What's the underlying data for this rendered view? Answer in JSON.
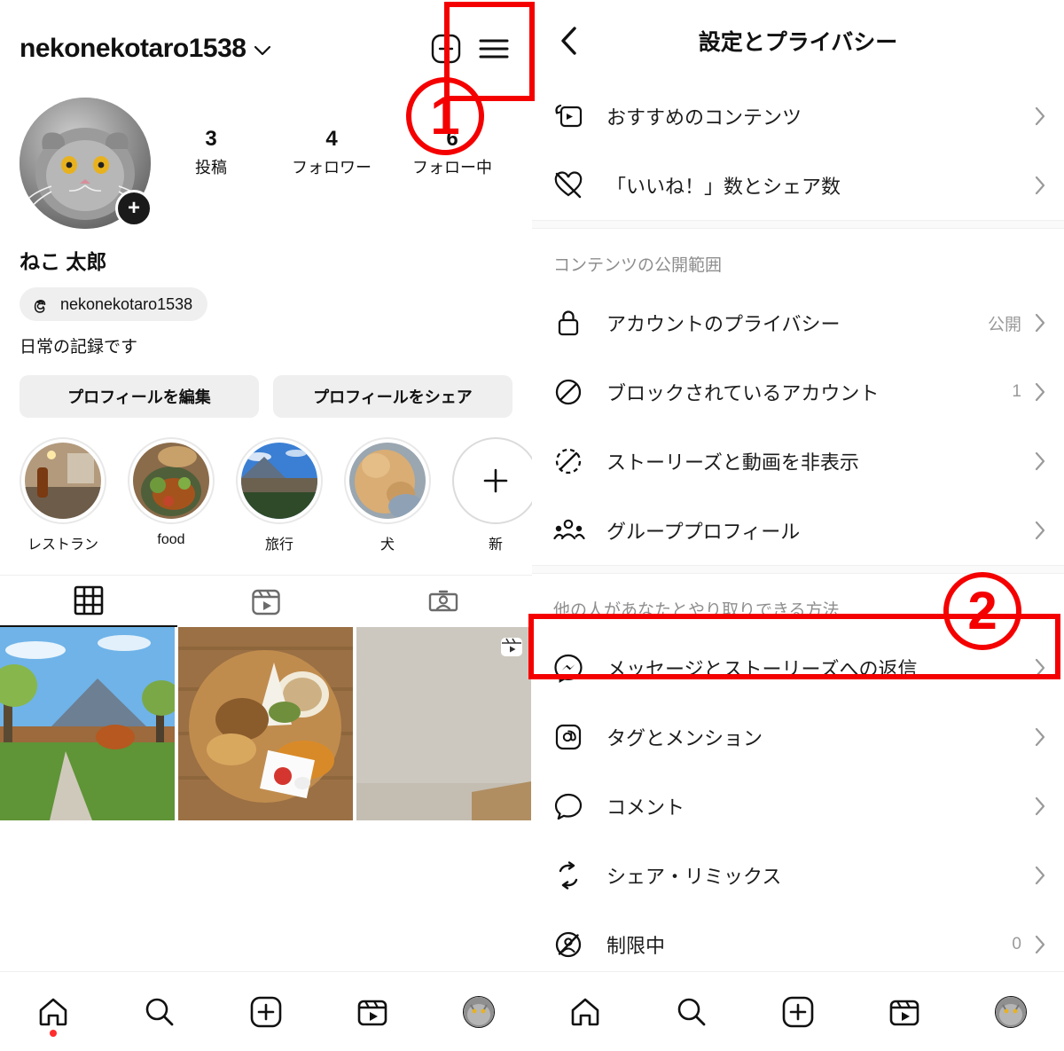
{
  "profile": {
    "username": "nekonekotaro1538",
    "display_name": "ねこ 太郎",
    "threads_handle": "nekonekotaro1538",
    "bio": "日常の記録です",
    "stats": [
      {
        "num": "3",
        "label": "投稿"
      },
      {
        "num": "4",
        "label": "フォロワー"
      },
      {
        "num": "6",
        "label": "フォロー中"
      }
    ],
    "buttons": {
      "edit_profile": "プロフィールを編集",
      "share_profile": "プロフィールをシェア"
    },
    "highlights": [
      {
        "label": "レストラン"
      },
      {
        "label": "food"
      },
      {
        "label": "旅行"
      },
      {
        "label": "犬"
      },
      {
        "label": "新"
      }
    ],
    "tabs": [
      {
        "name": "grid",
        "active": true
      },
      {
        "name": "reels",
        "active": false
      },
      {
        "name": "tagged",
        "active": false
      }
    ],
    "icons": {
      "add_post": "plus-square-icon",
      "menu": "hamburger-menu-icon",
      "dropdown": "chevron-down-icon",
      "avatar_add": "+"
    }
  },
  "settings": {
    "title": "設定とプライバシー",
    "back_icon": "back-chevron-icon",
    "items_top": [
      {
        "icon": "suggested-content-icon",
        "label": "おすすめのコンテンツ",
        "value": ""
      },
      {
        "icon": "heart-slash-icon",
        "label": "「いいね！」数とシェア数",
        "value": ""
      }
    ],
    "section1_header": "コンテンツの公開範囲",
    "items_section1": [
      {
        "icon": "lock-icon",
        "label": "アカウントのプライバシー",
        "value": "公開"
      },
      {
        "icon": "block-icon",
        "label": "ブロックされているアカウント",
        "value": "1"
      },
      {
        "icon": "story-hide-icon",
        "label": "ストーリーズと動画を非表示",
        "value": ""
      },
      {
        "icon": "group-profile-icon",
        "label": "グループプロフィール",
        "value": ""
      }
    ],
    "section2_header": "他の人があなたとやり取りできる方法",
    "items_section2": [
      {
        "icon": "messenger-icon",
        "label": "メッセージとストーリーズへの返信",
        "value": ""
      },
      {
        "icon": "at-mention-icon",
        "label": "タグとメンション",
        "value": ""
      },
      {
        "icon": "comment-icon",
        "label": "コメント",
        "value": ""
      },
      {
        "icon": "share-remix-icon",
        "label": "シェア・リミックス",
        "value": ""
      },
      {
        "icon": "restricted-icon",
        "label": "制限中",
        "value": "0"
      }
    ]
  },
  "bottom_nav": [
    {
      "icon": "home-icon",
      "badge": true
    },
    {
      "icon": "search-icon",
      "badge": false
    },
    {
      "icon": "create-icon",
      "badge": false
    },
    {
      "icon": "reels-icon",
      "badge": false
    },
    {
      "icon": "profile-avatar-icon",
      "badge": false
    }
  ],
  "annotations": [
    {
      "id": "1",
      "label": "1",
      "target": "hamburger-menu-icon"
    },
    {
      "id": "2",
      "label": "2",
      "target": "messages-and-story-replies-row"
    }
  ],
  "colors": {
    "annotation_red": "#f40000",
    "accent_text": "#111111",
    "muted_text": "#8e8e8e",
    "chip_bg": "#efefef"
  }
}
